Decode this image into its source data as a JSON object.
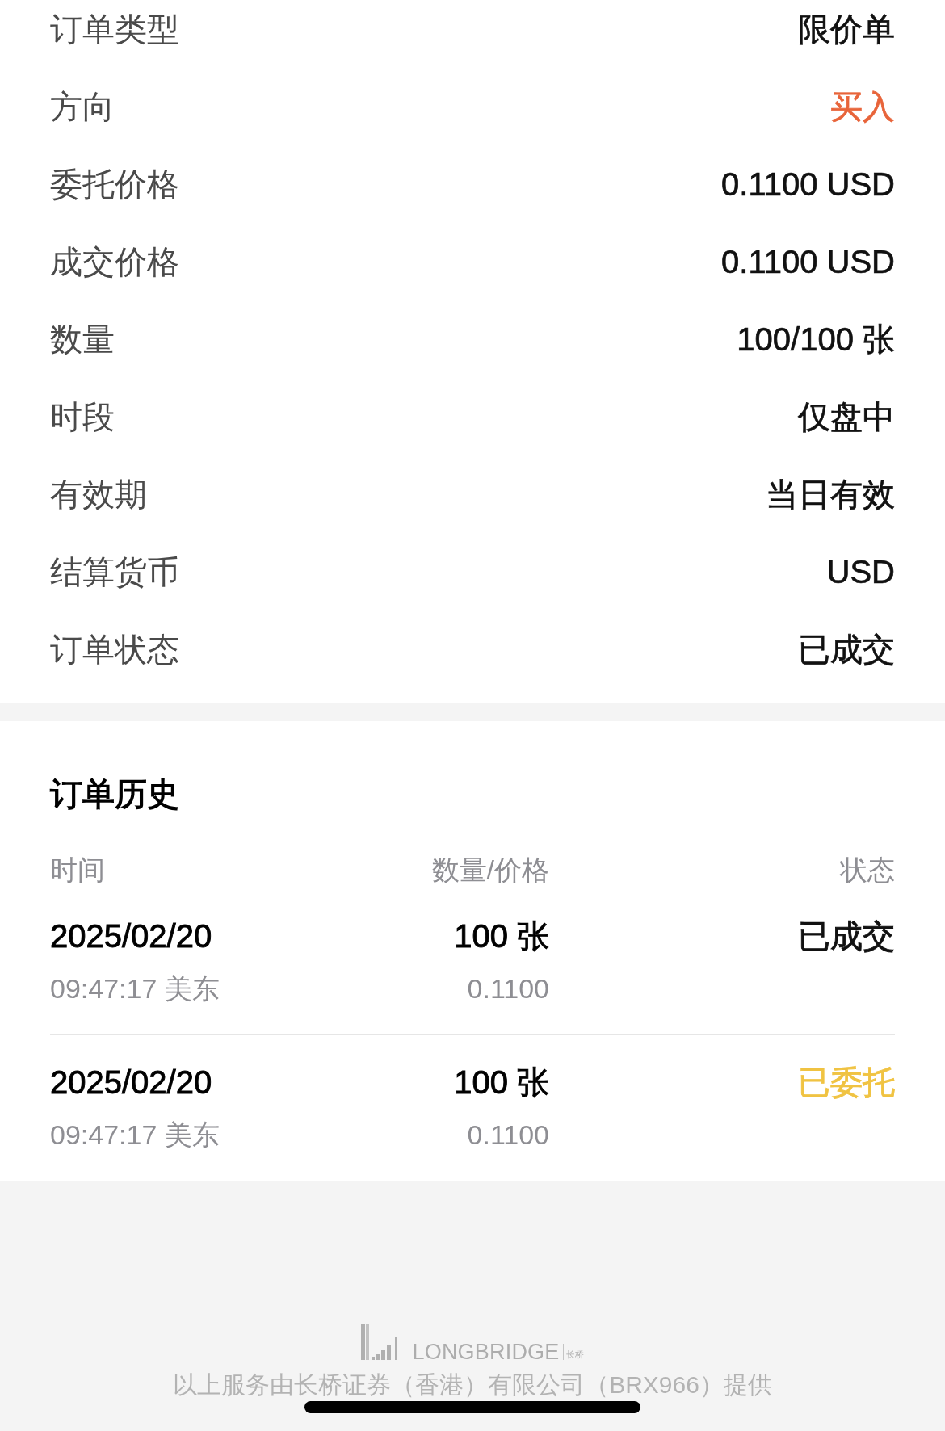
{
  "order_details": [
    {
      "label": "订单类型",
      "value": "限价单",
      "color": "#111111"
    },
    {
      "label": "方向",
      "value": "买入",
      "color": "#e8643a"
    },
    {
      "label": "委托价格",
      "value": "0.1100 USD",
      "color": "#111111"
    },
    {
      "label": "成交价格",
      "value": "0.1100 USD",
      "color": "#111111"
    },
    {
      "label": "数量",
      "value": "100/100 张",
      "color": "#111111"
    },
    {
      "label": "时段",
      "value": "仅盘中",
      "color": "#111111"
    },
    {
      "label": "有效期",
      "value": "当日有效",
      "color": "#111111"
    },
    {
      "label": "结算货币",
      "value": "USD",
      "color": "#111111"
    },
    {
      "label": "订单状态",
      "value": "已成交",
      "color": "#111111"
    }
  ],
  "order_history": {
    "title": "订单历史",
    "columns": [
      "时间",
      "数量/价格",
      "状态"
    ],
    "rows": [
      {
        "date": "2025/02/20",
        "time": "09:47:17 美东",
        "quantity": "100 张",
        "price": "0.1100",
        "status": "已成交",
        "color": "#111111"
      },
      {
        "date": "2025/02/20",
        "time": "09:47:17 美东",
        "quantity": "100 张",
        "price": "0.1100",
        "status": "已委托",
        "color": "#f0c342"
      }
    ]
  },
  "footer": {
    "logo_text": "LONGBRIDGE",
    "logo_subtext": "长桥",
    "disclaimer": "以上服务由长桥证券（香港）有限公司（BRX966）提供"
  }
}
